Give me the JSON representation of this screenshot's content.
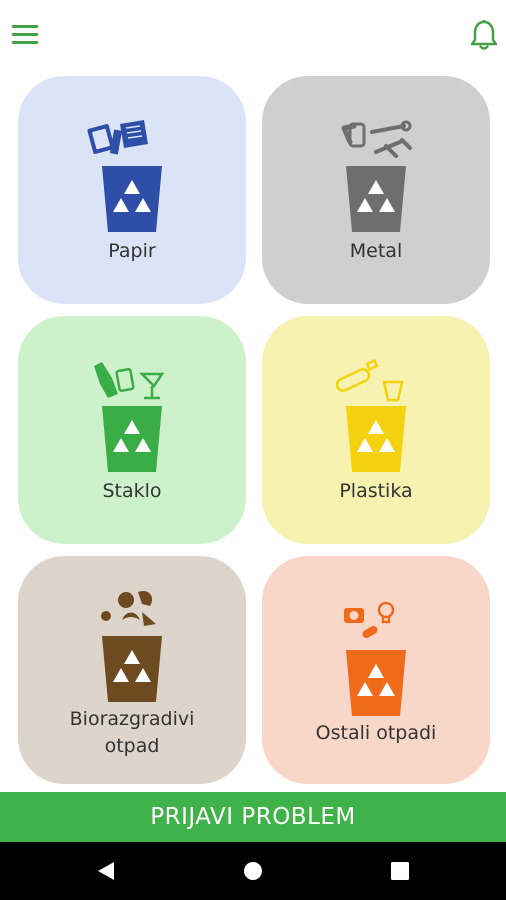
{
  "header": {
    "menu_icon": "hamburger-menu-icon",
    "bell_icon": "bell-icon",
    "accent_color": "#43a047"
  },
  "categories": [
    {
      "label": "Papir",
      "bg": "#dbe4f7",
      "bin": "#2f4ea8"
    },
    {
      "label": "Metal",
      "bg": "#cfcfcf",
      "bin": "#6e6e6e"
    },
    {
      "label": "Staklo",
      "bg": "#cdf2cb",
      "bin": "#3aad47"
    },
    {
      "label": "Plastika",
      "bg": "#f8f2b1",
      "bin": "#f4d20f"
    },
    {
      "label": "Biorazgradivi\notpad",
      "bg": "#ddd5cb",
      "bin": "#6e4a21"
    },
    {
      "label": "Ostali otpadi",
      "bg": "#f8d6c8",
      "bin": "#f06a1b"
    }
  ],
  "report_button": {
    "label": "PRIJAVI PROBLEM",
    "color": "#3fb24a"
  },
  "navbar": {
    "back_icon": "back-triangle-icon",
    "home_icon": "home-circle-icon",
    "recents_icon": "recents-square-icon"
  }
}
